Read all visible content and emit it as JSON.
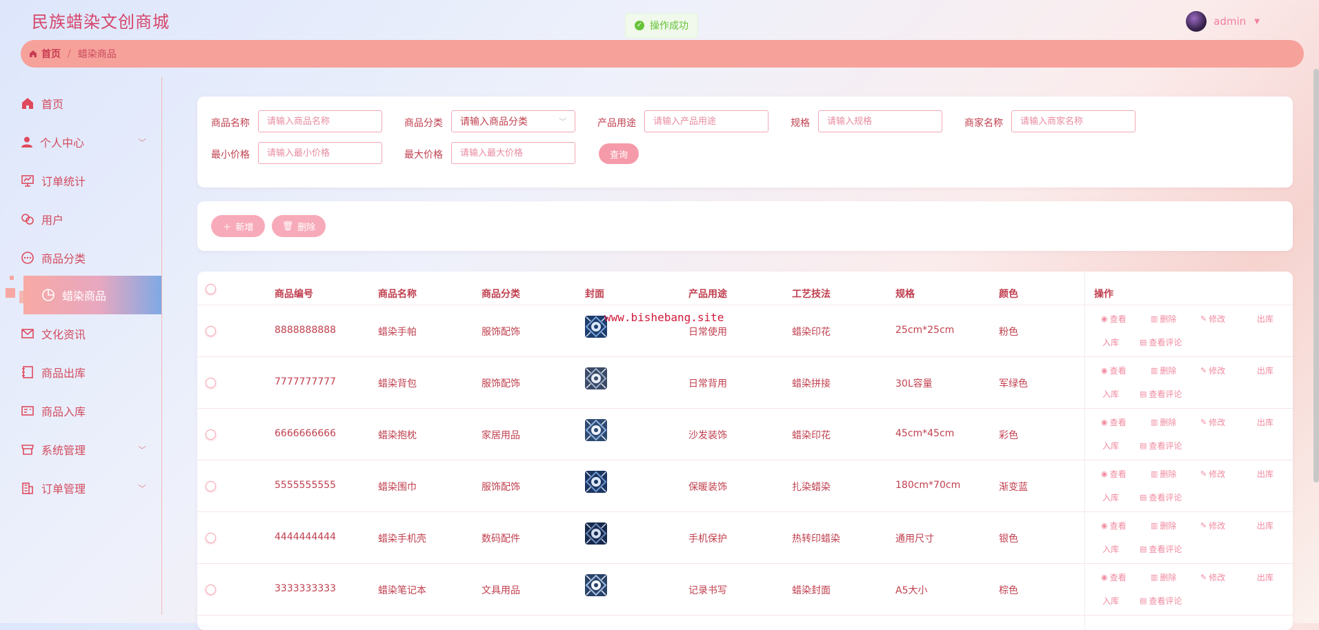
{
  "app": {
    "title": "民族蜡染文创商城"
  },
  "toast": {
    "message": "操作成功"
  },
  "user": {
    "name": "admin"
  },
  "breadcrumb": {
    "home": "首页",
    "separator": "/",
    "current": "蜡染商品"
  },
  "sidebar": {
    "items": [
      {
        "label": "首页",
        "icon": "home-icon"
      },
      {
        "label": "个人中心",
        "icon": "user-icon"
      },
      {
        "label": "订单统计",
        "icon": "chart-board-icon"
      },
      {
        "label": "用户",
        "icon": "link-icon"
      },
      {
        "label": "商品分类",
        "icon": "chat-dots-icon"
      },
      {
        "label": "蜡染商品",
        "icon": "pie-chart-icon"
      },
      {
        "label": "文化资讯",
        "icon": "mail-icon"
      },
      {
        "label": "商品出库",
        "icon": "notebook-icon"
      },
      {
        "label": "商品入库",
        "icon": "postcard-icon"
      },
      {
        "label": "系统管理",
        "icon": "shop-icon"
      },
      {
        "label": "订单管理",
        "icon": "office-building-icon"
      }
    ]
  },
  "search": {
    "fields": [
      {
        "label": "商品名称",
        "placeholder": "请输入商品名称"
      },
      {
        "label": "商品分类",
        "value": "请输入商品分类"
      },
      {
        "label": "产品用途",
        "placeholder": "请输入产品用途"
      },
      {
        "label": "规格",
        "placeholder": "请输入规格"
      },
      {
        "label": "商家名称",
        "placeholder": "请输入商家名称"
      },
      {
        "label": "最小价格",
        "placeholder": "请输入最小价格"
      },
      {
        "label": "最大价格",
        "placeholder": "请输入最大价格"
      }
    ],
    "query_label": "查询"
  },
  "toolbar": {
    "add_label": "新增",
    "delete_label": "删除"
  },
  "table": {
    "columns": [
      "商品编号",
      "商品名称",
      "商品分类",
      "封面",
      "产品用途",
      "工艺技法",
      "规格",
      "颜色",
      "操作"
    ],
    "ops": {
      "view": "查看",
      "delete": "删除",
      "edit": "修改",
      "out": "出库",
      "in": "入库",
      "comments": "查看评论"
    },
    "rows": [
      {
        "id": "8888888888",
        "name": "蜡染手帕",
        "category": "服饰配饰",
        "usage": "日常使用",
        "craft": "蜡染印花",
        "spec": "25cm*25cm",
        "color": "粉色"
      },
      {
        "id": "7777777777",
        "name": "蜡染背包",
        "category": "服饰配饰",
        "usage": "日常背用",
        "craft": "蜡染拼接",
        "spec": "30L容量",
        "color": "军绿色"
      },
      {
        "id": "6666666666",
        "name": "蜡染抱枕",
        "category": "家居用品",
        "usage": "沙发装饰",
        "craft": "蜡染印花",
        "spec": "45cm*45cm",
        "color": "彩色"
      },
      {
        "id": "5555555555",
        "name": "蜡染围巾",
        "category": "服饰配饰",
        "usage": "保暖装饰",
        "craft": "扎染蜡染",
        "spec": "180cm*70cm",
        "color": "渐变蓝"
      },
      {
        "id": "4444444444",
        "name": "蜡染手机壳",
        "category": "数码配件",
        "usage": "手机保护",
        "craft": "热转印蜡染",
        "spec": "通用尺寸",
        "color": "银色"
      },
      {
        "id": "3333333333",
        "name": "蜡染笔记本",
        "category": "文具用品",
        "usage": "记录书写",
        "craft": "蜡染封面",
        "spec": "A5大小",
        "color": "棕色"
      }
    ]
  },
  "watermark": "www.bishebang.site",
  "colors": {
    "accent": "#d6456a",
    "breadcrumb_bg": "#f7a19b",
    "button_pink": "#f59aa9",
    "success": "#67c23a"
  }
}
